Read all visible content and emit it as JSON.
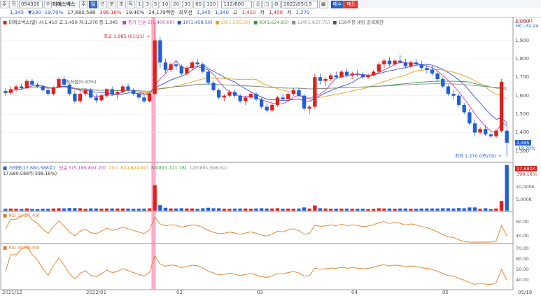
{
  "toolbar": {
    "menu_btn": "주",
    "period_btn": "전",
    "code_value": "054320",
    "name_icon": "search-icon",
    "stock_name": "티에스넥스",
    "tabs": [
      "주",
      "일",
      "년",
      "분",
      "초",
      "틱"
    ],
    "ticks": [
      "1",
      "3",
      "5",
      "10",
      "20",
      "30",
      "60",
      "120"
    ],
    "count_value": "112/600",
    "date_value": "2022/05/19",
    "buy_label": "매수",
    "sell_label": "매도"
  },
  "quote": {
    "price": "1,345",
    "change": "330",
    "change_pct": "-19.70%",
    "volume": "17,680,588",
    "vol_ratio": "398.16%",
    "turnover": "19.40%",
    "amount": "24,179백만",
    "best_label": "최우선",
    "open_label": "1,345",
    "o": "1,340",
    "h_label": "고",
    "h": "1,410",
    "l_label": "저",
    "l": "1,450",
    "c_label": "저",
    "c": "1,270"
  },
  "price_pane": {
    "legend": "티에스넥스(일) 시:1,410 고:1,450 저:1,270 종:1,345",
    "ma_legend": [
      {
        "text": "종가 단순 5(1,400.00)",
        "color": "#c43bb5"
      },
      {
        "text": "10(1,458.50)",
        "color": "#3b4fd6"
      },
      {
        "text": "20(1,535.50)",
        "color": "#e6a11c"
      },
      {
        "text": "60(1,624.83)",
        "color": "#2e9e3a"
      },
      {
        "text": "120(1,637.75)",
        "color": "#8c8c8c"
      },
      {
        "text": "150주봉 세팅 갈색제한",
        "color": "#555555"
      }
    ],
    "high_note": "최고 1,985 (01/21)",
    "low_note": "최저 1,270 (05/19)",
    "note_mid": "최저점(0.00%)",
    "y_labels": [
      "2,000",
      "1,900",
      "1,800",
      "1,700",
      "1,600",
      "1,500",
      "1,400",
      "1,300"
    ],
    "right_top": [
      "LC:5.91",
      "HC:-32.24"
    ],
    "price_badge": "1,345",
    "price_badge_pct": "-19.70%"
  },
  "volume_pane": {
    "legend_title": "거래량(17,680,588주)",
    "legend_sub": "17,680,588주(398.16%)",
    "ma_legend": [
      {
        "text": "단순 5(5,189,891.20)",
        "color": "#c43bb5"
      },
      {
        "text": "20(1,624,824.90)",
        "color": "#e6a11c"
      },
      {
        "text": "60(891,721.78)",
        "color": "#2e9e3a"
      },
      {
        "text": "120(891,998.82)",
        "color": "#8c8c8c"
      }
    ],
    "y_labels": [
      "10,000K",
      "5,000K"
    ],
    "badge": "17,681K",
    "badge_pct": "398.16%"
  },
  "rsi1": {
    "legend": "RSI 14(37.49)",
    "y_labels": [
      "60.00",
      "40.00"
    ]
  },
  "rsi2": {
    "legend": "RSI 30(39.00)",
    "y_labels": [
      "70.00",
      "60.00",
      "50.00",
      "40.00"
    ]
  },
  "x_labels": [
    "2021/12",
    "2022/01",
    "02",
    "03",
    "04",
    "05",
    "05/19"
  ],
  "chart_data": {
    "type": "candlestick",
    "ylim": [
      1250,
      2020
    ],
    "candles": [
      [
        1625,
        1640,
        1600,
        1615
      ],
      [
        1615,
        1650,
        1605,
        1635
      ],
      [
        1635,
        1660,
        1620,
        1650
      ],
      [
        1650,
        1665,
        1630,
        1640
      ],
      [
        1640,
        1690,
        1635,
        1680
      ],
      [
        1680,
        1690,
        1655,
        1660
      ],
      [
        1660,
        1670,
        1640,
        1650
      ],
      [
        1650,
        1660,
        1620,
        1630
      ],
      [
        1630,
        1640,
        1600,
        1610
      ],
      [
        1610,
        1650,
        1600,
        1645
      ],
      [
        1645,
        1700,
        1640,
        1690
      ],
      [
        1690,
        1705,
        1650,
        1660
      ],
      [
        1660,
        1670,
        1600,
        1610
      ],
      [
        1610,
        1625,
        1560,
        1570
      ],
      [
        1570,
        1620,
        1560,
        1610
      ],
      [
        1610,
        1640,
        1600,
        1630
      ],
      [
        1630,
        1640,
        1585,
        1590
      ],
      [
        1590,
        1610,
        1560,
        1575
      ],
      [
        1575,
        1610,
        1565,
        1600
      ],
      [
        1600,
        1640,
        1590,
        1635
      ],
      [
        1635,
        1650,
        1600,
        1610
      ],
      [
        1610,
        1630,
        1580,
        1620
      ],
      [
        1620,
        1660,
        1610,
        1650
      ],
      [
        1650,
        1665,
        1620,
        1630
      ],
      [
        1630,
        1640,
        1600,
        1610
      ],
      [
        1610,
        1620,
        1575,
        1590
      ],
      [
        1590,
        1605,
        1560,
        1570
      ],
      [
        1570,
        1620,
        1565,
        1610
      ],
      [
        1610,
        1985,
        1600,
        1900
      ],
      [
        1900,
        1920,
        1750,
        1780
      ],
      [
        1780,
        1800,
        1720,
        1740
      ],
      [
        1740,
        1780,
        1730,
        1770
      ],
      [
        1770,
        1790,
        1740,
        1760
      ],
      [
        1760,
        1770,
        1710,
        1720
      ],
      [
        1720,
        1760,
        1710,
        1750
      ],
      [
        1750,
        1790,
        1740,
        1780
      ],
      [
        1780,
        1800,
        1760,
        1770
      ],
      [
        1770,
        1780,
        1720,
        1730
      ],
      [
        1730,
        1740,
        1660,
        1670
      ],
      [
        1670,
        1680,
        1620,
        1630
      ],
      [
        1630,
        1640,
        1580,
        1590
      ],
      [
        1590,
        1610,
        1570,
        1600
      ],
      [
        1600,
        1630,
        1590,
        1620
      ],
      [
        1620,
        1635,
        1590,
        1600
      ],
      [
        1600,
        1610,
        1560,
        1570
      ],
      [
        1570,
        1600,
        1550,
        1590
      ],
      [
        1590,
        1620,
        1580,
        1610
      ],
      [
        1610,
        1620,
        1570,
        1580
      ],
      [
        1580,
        1590,
        1530,
        1540
      ],
      [
        1540,
        1560,
        1510,
        1520
      ],
      [
        1520,
        1560,
        1510,
        1550
      ],
      [
        1550,
        1600,
        1540,
        1590
      ],
      [
        1590,
        1610,
        1570,
        1580
      ],
      [
        1580,
        1620,
        1575,
        1610
      ],
      [
        1610,
        1640,
        1600,
        1630
      ],
      [
        1630,
        1640,
        1590,
        1600
      ],
      [
        1600,
        1610,
        1520,
        1530
      ],
      [
        1530,
        1550,
        1500,
        1540
      ],
      [
        1540,
        1720,
        1530,
        1700
      ],
      [
        1700,
        1720,
        1660,
        1680
      ],
      [
        1680,
        1700,
        1650,
        1690
      ],
      [
        1690,
        1720,
        1680,
        1710
      ],
      [
        1710,
        1730,
        1690,
        1700
      ],
      [
        1700,
        1740,
        1695,
        1730
      ],
      [
        1730,
        1745,
        1700,
        1710
      ],
      [
        1710,
        1730,
        1690,
        1720
      ],
      [
        1720,
        1740,
        1700,
        1715
      ],
      [
        1715,
        1730,
        1690,
        1700
      ],
      [
        1700,
        1720,
        1690,
        1710
      ],
      [
        1710,
        1740,
        1705,
        1730
      ],
      [
        1730,
        1780,
        1720,
        1770
      ],
      [
        1770,
        1800,
        1750,
        1790
      ],
      [
        1790,
        1810,
        1760,
        1770
      ],
      [
        1770,
        1800,
        1760,
        1790
      ],
      [
        1790,
        1820,
        1770,
        1780
      ],
      [
        1780,
        1800,
        1750,
        1760
      ],
      [
        1760,
        1790,
        1750,
        1780
      ],
      [
        1780,
        1800,
        1760,
        1770
      ],
      [
        1770,
        1790,
        1740,
        1750
      ],
      [
        1750,
        1770,
        1720,
        1740
      ],
      [
        1740,
        1760,
        1710,
        1720
      ],
      [
        1720,
        1730,
        1680,
        1690
      ],
      [
        1690,
        1700,
        1640,
        1650
      ],
      [
        1650,
        1660,
        1600,
        1610
      ],
      [
        1610,
        1630,
        1580,
        1600
      ],
      [
        1600,
        1610,
        1540,
        1550
      ],
      [
        1550,
        1560,
        1500,
        1510
      ],
      [
        1510,
        1530,
        1440,
        1450
      ],
      [
        1450,
        1470,
        1380,
        1400
      ],
      [
        1400,
        1430,
        1390,
        1420
      ],
      [
        1420,
        1440,
        1380,
        1390
      ],
      [
        1390,
        1400,
        1370,
        1380
      ],
      [
        1380,
        1420,
        1370,
        1410
      ],
      [
        1410,
        1690,
        1400,
        1675
      ],
      [
        1410,
        1450,
        1270,
        1345
      ]
    ]
  }
}
